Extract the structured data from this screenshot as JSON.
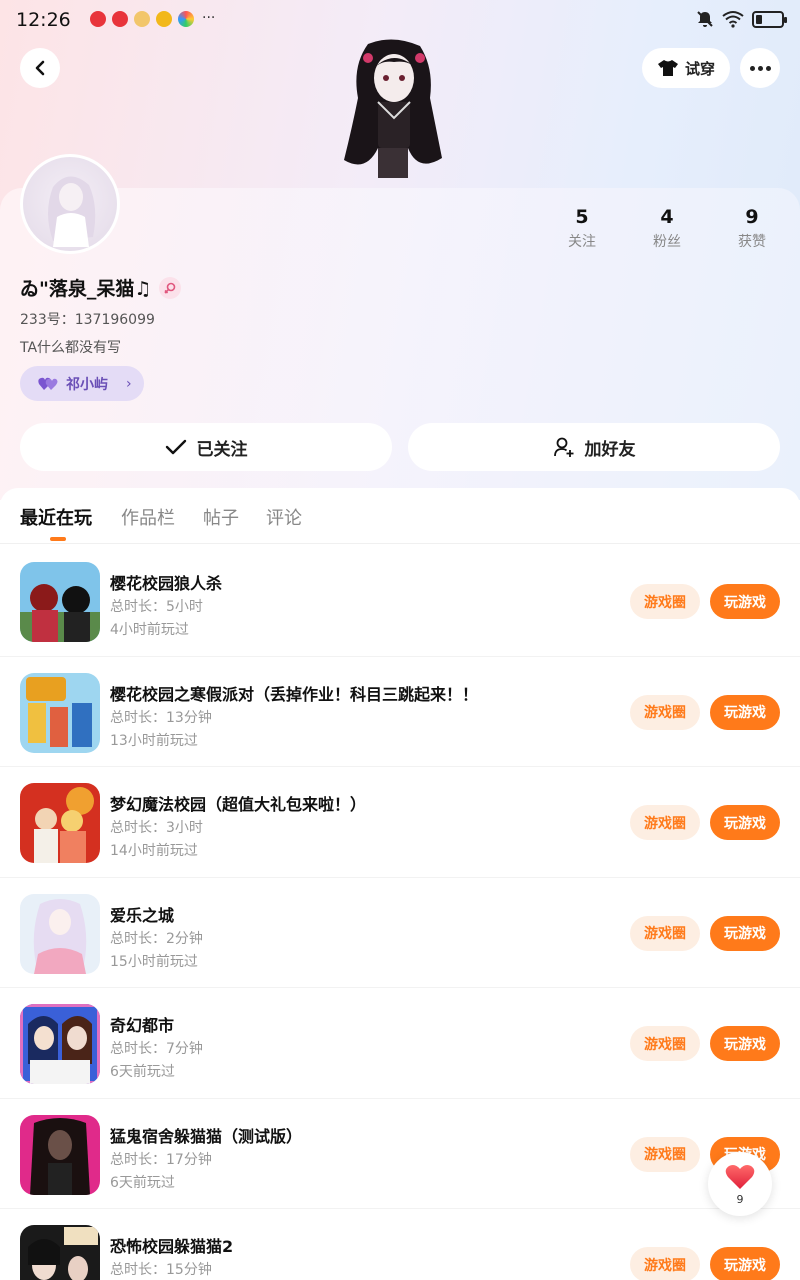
{
  "status_bar": {
    "time": "12:26",
    "more": "···"
  },
  "header": {
    "tryon_label": "试穿"
  },
  "profile": {
    "stats": [
      {
        "num": "5",
        "label": "关注"
      },
      {
        "num": "4",
        "label": "粉丝"
      },
      {
        "num": "9",
        "label": "获赞"
      }
    ],
    "nickname": "ゐ\"落泉_呆猫♫",
    "uid": "233号：137196099",
    "bio": "TA什么都没有写",
    "cp_name": "祁小屿",
    "cp_chevron": "›",
    "followed_label": "已关注",
    "add_friend_label": "加好友"
  },
  "tabs": [
    "最近在玩",
    "作品栏",
    "帖子",
    "评论"
  ],
  "games": [
    {
      "title": "樱花校园狼人杀",
      "duration": "总时长：5小时",
      "last_played": "4小时前玩过",
      "circle": "游戏圈",
      "play": "玩游戏"
    },
    {
      "title": "樱花校园之寒假派对（丢掉作业！科目三跳起来！！",
      "duration": "总时长：13分钟",
      "last_played": "13小时前玩过",
      "circle": "游戏圈",
      "play": "玩游戏"
    },
    {
      "title": "梦幻魔法校园（超值大礼包来啦！）",
      "duration": "总时长：3小时",
      "last_played": "14小时前玩过",
      "circle": "游戏圈",
      "play": "玩游戏"
    },
    {
      "title": "爱乐之城",
      "duration": "总时长：2分钟",
      "last_played": "15小时前玩过",
      "circle": "游戏圈",
      "play": "玩游戏"
    },
    {
      "title": "奇幻都市",
      "duration": "总时长：7分钟",
      "last_played": "6天前玩过",
      "circle": "游戏圈",
      "play": "玩游戏"
    },
    {
      "title": "猛鬼宿舍躲猫猫（测试版）",
      "duration": "总时长：17分钟",
      "last_played": "6天前玩过",
      "circle": "游戏圈",
      "play": "玩游戏"
    },
    {
      "title": "恐怖校园躲猫猫2",
      "duration": "总时长：15分钟",
      "last_played": "",
      "circle": "游戏圈",
      "play": "玩游戏"
    }
  ],
  "float_like": {
    "count": "9"
  },
  "colors": {
    "accent": "#ff7a1a",
    "accent_light": "#fdeee2",
    "cp_bg": "#e4dcf6"
  }
}
